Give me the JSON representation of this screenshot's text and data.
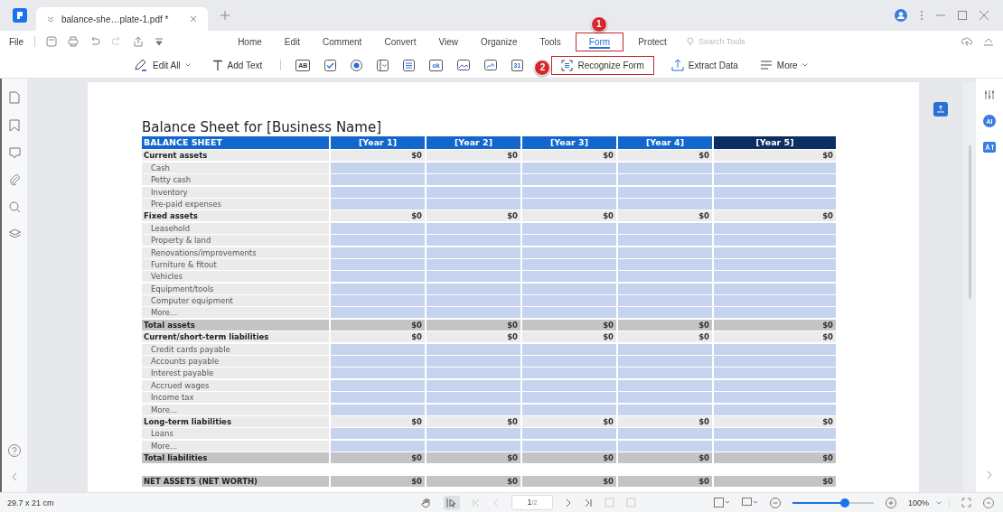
{
  "window": {
    "tab_title": "balance-she…plate-1.pdf *"
  },
  "menu": {
    "file": "File",
    "search": "Search Tools",
    "tabs": [
      {
        "label": "Home",
        "selected": false,
        "highlighted": false
      },
      {
        "label": "Edit",
        "selected": false,
        "highlighted": false
      },
      {
        "label": "Comment",
        "selected": false,
        "highlighted": false
      },
      {
        "label": "Convert",
        "selected": false,
        "highlighted": false
      },
      {
        "label": "View",
        "selected": false,
        "highlighted": false
      },
      {
        "label": "Organize",
        "selected": false,
        "highlighted": false
      },
      {
        "label": "Tools",
        "selected": false,
        "highlighted": false
      },
      {
        "label": "Form",
        "selected": true,
        "highlighted": true,
        "callout": "1"
      },
      {
        "label": "Protect",
        "selected": false,
        "highlighted": false
      }
    ]
  },
  "toolbar": {
    "edit_all": "Edit All",
    "add_text": "Add Text",
    "field_tools": [
      {
        "kind": "text",
        "glyph": "AB"
      },
      {
        "kind": "checkbox"
      },
      {
        "kind": "radio"
      },
      {
        "kind": "combo"
      },
      {
        "kind": "list"
      },
      {
        "kind": "button",
        "glyph": "ok"
      },
      {
        "kind": "image"
      },
      {
        "kind": "signature"
      },
      {
        "kind": "date",
        "glyph": "31"
      }
    ],
    "actions": [
      {
        "kind": "recognize",
        "label": "Recognize Form",
        "highlighted": true,
        "callout": "2"
      },
      {
        "kind": "extract",
        "label": "Extract Data",
        "highlighted": false
      },
      {
        "kind": "more",
        "label": "More",
        "highlighted": false
      }
    ]
  },
  "right_rail": {
    "ai": "AI"
  },
  "document": {
    "title": "Balance Sheet for [Business Name]",
    "header": [
      "BALANCE SHEET",
      "[Year 1]",
      "[Year 2]",
      "[Year 3]",
      "[Year 4]",
      "[Year 5]"
    ],
    "rows": [
      {
        "kind": "section",
        "label": "Current assets",
        "values": [
          "$0",
          "$0",
          "$0",
          "$0",
          "$0"
        ]
      },
      {
        "kind": "item",
        "label": "Cash"
      },
      {
        "kind": "item",
        "label": "Petty cash"
      },
      {
        "kind": "item",
        "label": "Inventory"
      },
      {
        "kind": "item",
        "label": "Pre-paid expenses"
      },
      {
        "kind": "section",
        "label": "Fixed assets",
        "values": [
          "$0",
          "$0",
          "$0",
          "$0",
          "$0"
        ]
      },
      {
        "kind": "item",
        "label": "Leasehold"
      },
      {
        "kind": "item",
        "label": "Property & land"
      },
      {
        "kind": "item",
        "label": "Renovations/improvements"
      },
      {
        "kind": "item",
        "label": "Furniture & fitout"
      },
      {
        "kind": "item",
        "label": "Vehicles"
      },
      {
        "kind": "item",
        "label": "Equipment/tools"
      },
      {
        "kind": "item",
        "label": "Computer equipment"
      },
      {
        "kind": "item",
        "label": "More..."
      },
      {
        "kind": "total",
        "label": "Total assets",
        "values": [
          "$0",
          "$0",
          "$0",
          "$0",
          "$0"
        ]
      },
      {
        "kind": "section",
        "label": "Current/short-term liabilities",
        "values": [
          "$0",
          "$0",
          "$0",
          "$0",
          "$0"
        ]
      },
      {
        "kind": "item",
        "label": "Credit cards payable"
      },
      {
        "kind": "item",
        "label": "Accounts payable"
      },
      {
        "kind": "item",
        "label": "Interest payable"
      },
      {
        "kind": "item",
        "label": "Accrued wages"
      },
      {
        "kind": "item",
        "label": "Income tax"
      },
      {
        "kind": "item",
        "label": "More..."
      },
      {
        "kind": "section",
        "label": "Long-term liabilities",
        "values": [
          "$0",
          "$0",
          "$0",
          "$0",
          "$0"
        ]
      },
      {
        "kind": "item",
        "label": "Loans"
      },
      {
        "kind": "item",
        "label": "More..."
      },
      {
        "kind": "total",
        "label": "Total liabilities",
        "values": [
          "$0",
          "$0",
          "$0",
          "$0",
          "$0"
        ]
      },
      {
        "kind": "spacer"
      },
      {
        "kind": "total",
        "label": "NET ASSETS (NET WORTH)",
        "values": [
          "$0",
          "$0",
          "$0",
          "$0",
          "$0"
        ]
      }
    ]
  },
  "status_bar": {
    "size": "29.7 x 21 cm",
    "page": "1",
    "pages": "/2",
    "zoom": "100%",
    "zoom_slider": {
      "level": 0.65
    }
  }
}
